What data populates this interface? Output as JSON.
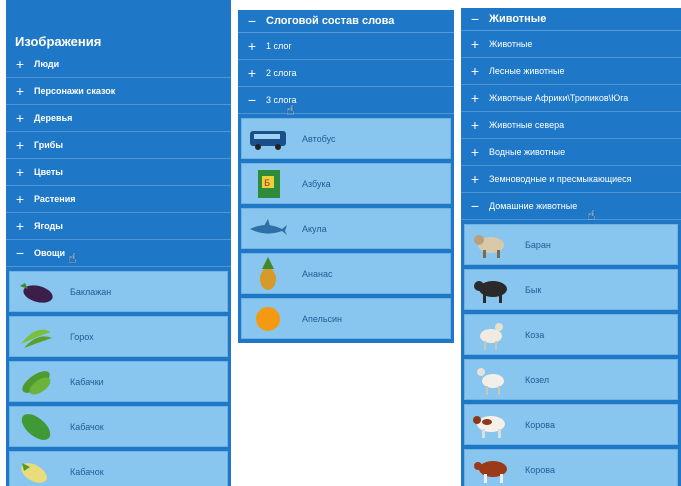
{
  "panel_left": {
    "title": "Изображения",
    "items": [
      {
        "sign": "+",
        "label": "Люди"
      },
      {
        "sign": "+",
        "label": "Персонажи сказок"
      },
      {
        "sign": "+",
        "label": "Деревья"
      },
      {
        "sign": "+",
        "label": "Грибы"
      },
      {
        "sign": "+",
        "label": "Цветы"
      },
      {
        "sign": "+",
        "label": "Растения"
      },
      {
        "sign": "+",
        "label": "Ягоды"
      },
      {
        "sign": "−",
        "label": "Овощи"
      }
    ],
    "cards": [
      {
        "label": "Баклажан",
        "icon": "eggplant-icon"
      },
      {
        "label": "Горох",
        "icon": "peas-icon"
      },
      {
        "label": "Кабачки",
        "icon": "zucchini-icon"
      },
      {
        "label": "Кабачок",
        "icon": "cucumber-icon"
      },
      {
        "label": "Кабачок",
        "icon": "squash-icon"
      }
    ]
  },
  "panel_middle": {
    "header": {
      "sign": "−",
      "label": "Слоговой состав слова"
    },
    "items": [
      {
        "sign": "+",
        "label": "1 слог"
      },
      {
        "sign": "+",
        "label": "2 слога"
      },
      {
        "sign": "−",
        "label": "3 слога"
      }
    ],
    "cards": [
      {
        "label": "Автобус",
        "icon": "bus-icon"
      },
      {
        "label": "Азбука",
        "icon": "alphabet-book-icon"
      },
      {
        "label": "Акула",
        "icon": "shark-icon"
      },
      {
        "label": "Ананас",
        "icon": "pineapple-icon"
      },
      {
        "label": "Апельсин",
        "icon": "orange-icon"
      }
    ]
  },
  "panel_right": {
    "header": {
      "sign": "−",
      "label": "Животные"
    },
    "items": [
      {
        "sign": "+",
        "label": "Животные"
      },
      {
        "sign": "+",
        "label": "Лесные животные"
      },
      {
        "sign": "+",
        "label": "Животные Африки\\Тропиков\\Юга"
      },
      {
        "sign": "+",
        "label": "Животные севера"
      },
      {
        "sign": "+",
        "label": "Водные животные"
      },
      {
        "sign": "+",
        "label": "Земноводные и пресмыкающиеся"
      },
      {
        "sign": "−",
        "label": "Домашние животные"
      }
    ],
    "cards": [
      {
        "label": "Баран",
        "icon": "ram-icon"
      },
      {
        "label": "Бык",
        "icon": "bull-icon"
      },
      {
        "label": "Коза",
        "icon": "goat-icon"
      },
      {
        "label": "Козел",
        "icon": "billy-goat-icon"
      },
      {
        "label": "Корова",
        "icon": "cow-icon"
      },
      {
        "label": "Корова",
        "icon": "brown-cow-icon"
      }
    ]
  },
  "colors": {
    "panel": "#1f78c7",
    "card": "#88c6ef",
    "card_text": "#1f5e96"
  }
}
